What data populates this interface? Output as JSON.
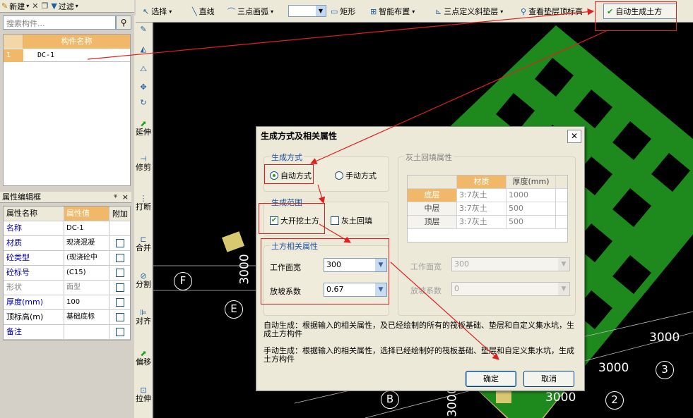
{
  "left_toolbar": {
    "new_label": "新建",
    "filter_label": "过滤"
  },
  "search": {
    "placeholder": "搜索构件..."
  },
  "component_list": {
    "header": "构件名称",
    "rows": [
      {
        "num": "1",
        "name": "DC-1"
      }
    ]
  },
  "property_panel": {
    "title": "属性编辑框",
    "pin": "ᵠ",
    "close": "×",
    "col_name": "属性名称",
    "col_value": "属性值",
    "col_extra": "附加",
    "rows": [
      {
        "name": "名称",
        "value": "DC-1"
      },
      {
        "name": "材质",
        "value": "现浇混凝"
      },
      {
        "name": "砼类型",
        "value": "(现浇砼中"
      },
      {
        "name": "砼标号",
        "value": "(C15)"
      },
      {
        "name": "形状",
        "value": "面型"
      },
      {
        "name": "厚度(mm)",
        "value": "100"
      },
      {
        "name": "顶标高(m)",
        "value": "基础底标"
      },
      {
        "name": "备注",
        "value": ""
      }
    ]
  },
  "vertical_tools": [
    {
      "label": "延伸"
    },
    {
      "label": "修剪"
    },
    {
      "label": "打断"
    },
    {
      "label": "合并"
    },
    {
      "label": "分割"
    },
    {
      "label": "对齐"
    },
    {
      "label": "偏移"
    },
    {
      "label": "拉伸"
    }
  ],
  "top_toolbar": {
    "select": "选择",
    "line": "直线",
    "arc": "三点画弧",
    "rect": "矩形",
    "smart": "智能布置",
    "slope": "三点定义斜垫层",
    "view_elev": "查看垫层顶标高",
    "auto_gen": "自动生成土方"
  },
  "canvas": {
    "dims": [
      "3000",
      "3000",
      "3000",
      "3000",
      "3000"
    ],
    "axes": [
      "F",
      "E",
      "B",
      "2",
      "3"
    ]
  },
  "dialog": {
    "title": "生成方式及相关属性",
    "close": "✕",
    "gen_mode": {
      "title": "生成方式",
      "auto": "自动方式",
      "manual": "手动方式"
    },
    "gen_range": {
      "title": "生成范围",
      "excavation": "大开挖土方",
      "backfill": "灰土回填"
    },
    "earth_props": {
      "title": "土方相关属性",
      "work_width_label": "工作面宽",
      "work_width_value": "300",
      "slope_label": "放坡系数",
      "slope_value": "0.67"
    },
    "backfill_props": {
      "title": "灰土回填属性",
      "col_material": "材质",
      "col_thickness": "厚度(mm)",
      "rows": [
        {
          "layer": "底层",
          "material": "3:7灰土",
          "thickness": "1000"
        },
        {
          "layer": "中层",
          "material": "3:7灰土",
          "thickness": "500"
        },
        {
          "layer": "顶层",
          "material": "3:7灰土",
          "thickness": "500"
        }
      ],
      "work_width_label": "工作面宽",
      "work_width_value": "300",
      "slope_label": "放坡系数",
      "slope_value": "0"
    },
    "note_auto": "自动生成：根据输入的相关属性，及已经绘制的所有的筏板基础、垫层和自定义集水坑，生成土方构件",
    "note_manual": "手动生成：根据输入的相关属性，选择已经绘制好的筏板基础、垫层和自定义集水坑，生成土方构件",
    "ok": "确定",
    "cancel": "取消"
  },
  "colors": {
    "canvas_bg": "#000000",
    "slab_green": "#1e8a1e",
    "annotation_red": "#e02020",
    "header_orange": "#f0b868"
  }
}
